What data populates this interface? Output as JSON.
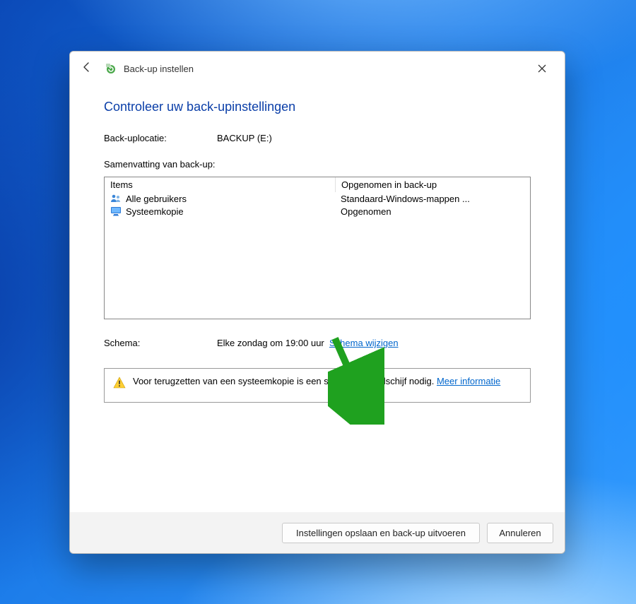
{
  "header": {
    "title": "Back-up instellen"
  },
  "main": {
    "heading": "Controleer uw back-upinstellingen",
    "location_label": "Back-uplocatie:",
    "location_value": "BACKUP (E:)",
    "summary_label": "Samenvatting van back-up:",
    "table": {
      "col1": "Items",
      "col2": "Opgenomen in back-up",
      "rows": [
        {
          "icon": "users",
          "item": "Alle gebruikers",
          "included": "Standaard-Windows-mappen ..."
        },
        {
          "icon": "monitor",
          "item": "Systeemkopie",
          "included": "Opgenomen"
        }
      ]
    },
    "schedule_label": "Schema:",
    "schedule_value": "Elke zondag om 19:00 uur",
    "schedule_change_link": "Schema wijzigen",
    "notice_text": "Voor terugzetten van een systeemkopie is een systeemherstelschijf nodig. ",
    "notice_link": "Meer informatie"
  },
  "footer": {
    "save_label": "Instellingen opslaan en back-up uitvoeren",
    "cancel_label": "Annuleren"
  }
}
